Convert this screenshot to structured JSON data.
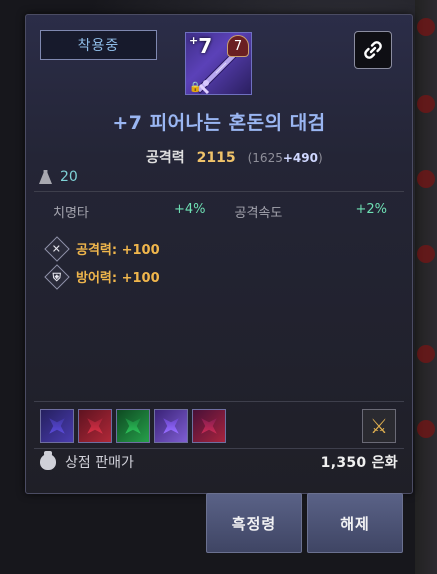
{
  "item": {
    "equipped_label": "착용중",
    "enhance_level": "7",
    "enhance_plus": "+",
    "tier": "7",
    "title": "+7 피어나는 혼돈의 대검",
    "main_stat": {
      "label": "공격력",
      "value": "2115",
      "base": "1625",
      "bonus": "+490"
    },
    "weight": "20",
    "sub_stats": [
      {
        "label": "치명타",
        "value": "+4%"
      },
      {
        "label": "공격속도",
        "value": "+2%"
      }
    ],
    "options": [
      {
        "icon": "crossed-swords-icon",
        "text": "공격력: +100"
      },
      {
        "icon": "shield-icon",
        "text": "방어력: +100"
      }
    ],
    "gems": [
      "blue",
      "red",
      "green",
      "violet",
      "crimson"
    ],
    "price": {
      "label": "상점 판매가",
      "value": "1,350 은화"
    }
  },
  "buttons": {
    "absorb": "흑정령",
    "unequip": "해제"
  },
  "colors": {
    "title": "#9ab6f2",
    "main_stat": "#f0c36a",
    "sub_stat_value": "#6ee0b4",
    "option_text": "#f0b64c"
  }
}
